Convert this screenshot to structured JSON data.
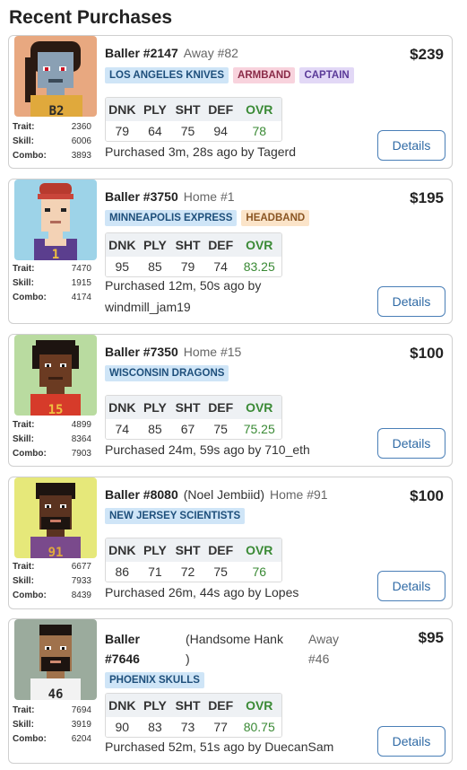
{
  "page_title": "Recent Purchases",
  "rating_headers": [
    "DNK",
    "PLY",
    "SHT",
    "DEF",
    "OVR"
  ],
  "stat_labels": {
    "trait": "Trait:",
    "skill": "Skill:",
    "combo": "Combo:"
  },
  "details_label": "Details",
  "purchases": [
    {
      "baller_id": "Baller #2147",
      "nickname": "",
      "location": "Away #82",
      "price": "$239",
      "tags": [
        "LOS ANGELES KNIVES",
        "ARMBAND",
        "CAPTAIN"
      ],
      "ratings": [
        "79",
        "64",
        "75",
        "94",
        "78"
      ],
      "purchased": "Purchased 3m, 28s ago by Tagerd",
      "stats": {
        "trait": "2360",
        "skill": "6006",
        "combo": "3893"
      },
      "jersey": "B2",
      "colors": {
        "bg": "#e8a880",
        "skin": "#8aa0b4",
        "jersey": "#e0a93c"
      }
    },
    {
      "baller_id": "Baller #3750",
      "nickname": "",
      "location": "Home #1",
      "price": "$195",
      "tags": [
        "MINNEAPOLIS EXPRESS",
        "HEADBAND"
      ],
      "ratings": [
        "95",
        "85",
        "79",
        "74",
        "83.25"
      ],
      "purchased_line1": "Purchased 12m, 50s ago by",
      "purchased_line2": "windmill_jam19",
      "stats": {
        "trait": "7470",
        "skill": "1915",
        "combo": "4174"
      },
      "jersey": "1",
      "colors": {
        "bg": "#9dd3e8",
        "skin": "#f3d2b5",
        "jersey": "#5b3e8e"
      }
    },
    {
      "baller_id": "Baller #7350",
      "nickname": "",
      "location": "Home #15",
      "price": "$100",
      "tags": [
        "WISCONSIN DRAGONS"
      ],
      "ratings": [
        "74",
        "85",
        "67",
        "75",
        "75.25"
      ],
      "purchased": "Purchased 24m, 59s ago by 710_eth",
      "stats": {
        "trait": "4899",
        "skill": "8364",
        "combo": "7903"
      },
      "jersey": "15",
      "colors": {
        "bg": "#b9dba0",
        "skin": "#6b3b22",
        "jersey": "#d63b2a"
      }
    },
    {
      "baller_id": "Baller #8080",
      "nickname": "(Noel Jembiid)",
      "location": "Home #91",
      "price": "$100",
      "tags": [
        "NEW JERSEY SCIENTISTS"
      ],
      "ratings": [
        "86",
        "71",
        "72",
        "75",
        "76"
      ],
      "purchased": "Purchased 26m, 44s ago by Lopes",
      "stats": {
        "trait": "6677",
        "skill": "7933",
        "combo": "8439"
      },
      "jersey": "91",
      "colors": {
        "bg": "#e6e87a",
        "skin": "#5a3320",
        "jersey": "#7a4a8c"
      }
    },
    {
      "baller_id_line1": "Baller",
      "baller_id_line2": "#7646",
      "nickname_line1": "(Handsome Hank",
      "nickname_line2": ")",
      "location_line1": "Away",
      "location_line2": "#46",
      "price": "$95",
      "tags": [
        "PHOENIX SKULLS"
      ],
      "ratings": [
        "90",
        "83",
        "73",
        "77",
        "80.75"
      ],
      "purchased": "Purchased 52m, 51s ago by DuecanSam",
      "stats": {
        "trait": "7694",
        "skill": "3919",
        "combo": "6204"
      },
      "jersey": "46",
      "colors": {
        "bg": "#9bab9d",
        "skin": "#a0724c",
        "jersey": "#f2f2f2"
      }
    }
  ]
}
